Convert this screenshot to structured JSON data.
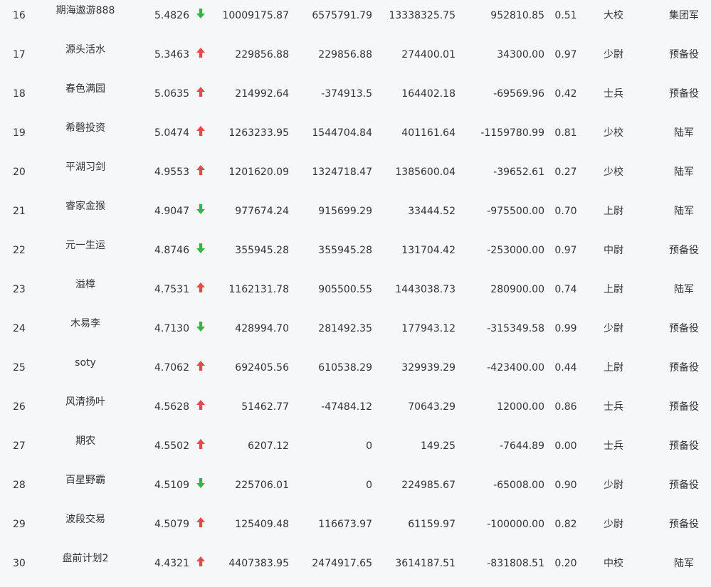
{
  "colors": {
    "background": "#f6f7f9",
    "text": "#333333",
    "up": "#e84a4a",
    "down": "#2fb84a"
  },
  "icons": {
    "up": "up-arrow-icon",
    "down": "down-arrow-icon"
  },
  "rows": [
    {
      "rank": "16",
      "name": "期海遨游888",
      "score": "5.4826",
      "trend": "down",
      "v1": "10009175.87",
      "v2": "6575791.79",
      "v3": "13338325.75",
      "v4": "952810.85",
      "ratio": "0.51",
      "grade": "大校",
      "category": "集团军"
    },
    {
      "rank": "17",
      "name": "源头活水",
      "score": "5.3463",
      "trend": "up",
      "v1": "229856.88",
      "v2": "229856.88",
      "v3": "274400.01",
      "v4": "34300.00",
      "ratio": "0.97",
      "grade": "少尉",
      "category": "预备役"
    },
    {
      "rank": "18",
      "name": "春色满园",
      "score": "5.0635",
      "trend": "up",
      "v1": "214992.64",
      "v2": "-374913.5",
      "v3": "164402.18",
      "v4": "-69569.96",
      "ratio": "0.42",
      "grade": "士兵",
      "category": "预备役"
    },
    {
      "rank": "19",
      "name": "希磬投资",
      "score": "5.0474",
      "trend": "up",
      "v1": "1263233.95",
      "v2": "1544704.84",
      "v3": "401161.64",
      "v4": "-1159780.99",
      "ratio": "0.81",
      "grade": "少校",
      "category": "陆军"
    },
    {
      "rank": "20",
      "name": "平湖习剑",
      "score": "4.9553",
      "trend": "up",
      "v1": "1201620.09",
      "v2": "1324718.47",
      "v3": "1385600.04",
      "v4": "-39652.61",
      "ratio": "0.27",
      "grade": "少校",
      "category": "陆军"
    },
    {
      "rank": "21",
      "name": "睿家金猴",
      "score": "4.9047",
      "trend": "down",
      "v1": "977674.24",
      "v2": "915699.29",
      "v3": "33444.52",
      "v4": "-975500.00",
      "ratio": "0.70",
      "grade": "上尉",
      "category": "陆军"
    },
    {
      "rank": "22",
      "name": "元一生运",
      "score": "4.8746",
      "trend": "down",
      "v1": "355945.28",
      "v2": "355945.28",
      "v3": "131704.42",
      "v4": "-253000.00",
      "ratio": "0.97",
      "grade": "中尉",
      "category": "预备役"
    },
    {
      "rank": "23",
      "name": "溢樟",
      "score": "4.7531",
      "trend": "up",
      "v1": "1162131.78",
      "v2": "905500.55",
      "v3": "1443038.73",
      "v4": "280900.00",
      "ratio": "0.74",
      "grade": "上尉",
      "category": "陆军"
    },
    {
      "rank": "24",
      "name": "木易李",
      "score": "4.7130",
      "trend": "down",
      "v1": "428994.70",
      "v2": "281492.35",
      "v3": "177943.12",
      "v4": "-315349.58",
      "ratio": "0.99",
      "grade": "少尉",
      "category": "预备役"
    },
    {
      "rank": "25",
      "name": "soty",
      "score": "4.7062",
      "trend": "up",
      "v1": "692405.56",
      "v2": "610538.29",
      "v3": "329939.29",
      "v4": "-423400.00",
      "ratio": "0.44",
      "grade": "上尉",
      "category": "预备役"
    },
    {
      "rank": "26",
      "name": "风清扬叶",
      "score": "4.5628",
      "trend": "up",
      "v1": "51462.77",
      "v2": "-47484.12",
      "v3": "70643.29",
      "v4": "12000.00",
      "ratio": "0.86",
      "grade": "士兵",
      "category": "预备役"
    },
    {
      "rank": "27",
      "name": "期农",
      "score": "4.5502",
      "trend": "up",
      "v1": "6207.12",
      "v2": "0",
      "v3": "149.25",
      "v4": "-7644.89",
      "ratio": "0.00",
      "grade": "士兵",
      "category": "预备役"
    },
    {
      "rank": "28",
      "name": "百星野霸",
      "score": "4.5109",
      "trend": "down",
      "v1": "225706.01",
      "v2": "0",
      "v3": "224985.67",
      "v4": "-65008.00",
      "ratio": "0.90",
      "grade": "少尉",
      "category": "预备役"
    },
    {
      "rank": "29",
      "name": "波段交易",
      "score": "4.5079",
      "trend": "up",
      "v1": "125409.48",
      "v2": "116673.97",
      "v3": "61159.97",
      "v4": "-100000.00",
      "ratio": "0.82",
      "grade": "少尉",
      "category": "预备役"
    },
    {
      "rank": "30",
      "name": "盘前计划2",
      "score": "4.4321",
      "trend": "up",
      "v1": "4407383.95",
      "v2": "2474917.65",
      "v3": "3614187.51",
      "v4": "-831808.51",
      "ratio": "0.20",
      "grade": "中校",
      "category": "陆军"
    }
  ]
}
